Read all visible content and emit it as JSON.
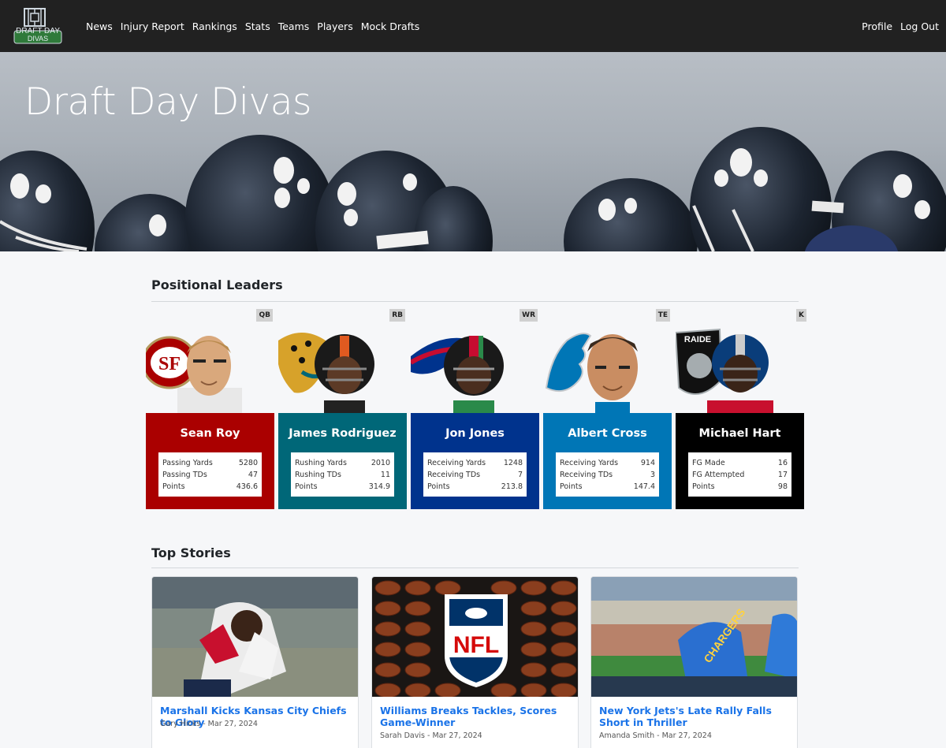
{
  "nav": {
    "logo_text_top": "DRAFT DAY",
    "logo_text_bottom": "DIVAS",
    "links": [
      "News",
      "Injury Report",
      "Rankings",
      "Stats",
      "Teams",
      "Players",
      "Mock Drafts"
    ],
    "right": [
      "Profile",
      "Log Out"
    ]
  },
  "hero": {
    "title": "Draft Day Divas"
  },
  "leaders_section": {
    "title": "Positional Leaders",
    "leaders": [
      {
        "position": "QB",
        "name": "Sean Roy",
        "team_logo": "49ers-logo",
        "color": "#aa0000",
        "stats": [
          {
            "label": "Passing Yards",
            "value": "5280"
          },
          {
            "label": "Passing TDs",
            "value": "47"
          },
          {
            "label": "Points",
            "value": "436.6"
          }
        ]
      },
      {
        "position": "RB",
        "name": "James Rodriguez",
        "team_logo": "jaguars-logo",
        "color": "#006778",
        "stats": [
          {
            "label": "Rushing Yards",
            "value": "2010"
          },
          {
            "label": "Rushing TDs",
            "value": "11"
          },
          {
            "label": "Points",
            "value": "314.9"
          }
        ]
      },
      {
        "position": "WR",
        "name": "Jon Jones",
        "team_logo": "bills-logo",
        "color": "#00338d",
        "stats": [
          {
            "label": "Receiving Yards",
            "value": "1248"
          },
          {
            "label": "Receiving TDs",
            "value": "7"
          },
          {
            "label": "Points",
            "value": "213.8"
          }
        ]
      },
      {
        "position": "TE",
        "name": "Albert Cross",
        "team_logo": "lions-logo",
        "color": "#0076b6",
        "stats": [
          {
            "label": "Receiving Yards",
            "value": "914"
          },
          {
            "label": "Receiving TDs",
            "value": "3"
          },
          {
            "label": "Points",
            "value": "147.4"
          }
        ]
      },
      {
        "position": "K",
        "name": "Michael Hart",
        "team_logo": "raiders-logo",
        "color": "#000000",
        "stats": [
          {
            "label": "FG Made",
            "value": "16"
          },
          {
            "label": "FG Attempted",
            "value": "17"
          },
          {
            "label": "Points",
            "value": "98"
          }
        ]
      }
    ]
  },
  "stories_section": {
    "title": "Top Stories",
    "stories": [
      {
        "title": "Marshall Kicks Kansas City Chiefs to Glory",
        "author": "Gary Hicks",
        "date": "Mar 27, 2024"
      },
      {
        "title": "Williams Breaks Tackles, Scores Game-Winner",
        "author": "Sarah Davis",
        "date": "Mar 27, 2024"
      },
      {
        "title": "New York Jets's Late Rally Falls Short in Thriller",
        "author": "Amanda Smith",
        "date": "Mar 27, 2024"
      }
    ]
  },
  "colors": {
    "navbar": "#212121",
    "link": "#1a73e8",
    "page_bg": "#f6f7f9"
  }
}
